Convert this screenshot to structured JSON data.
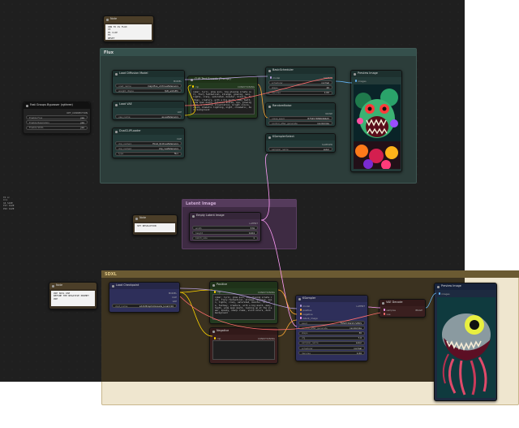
{
  "colors": {
    "flux_group": "#2f4642",
    "sdxl_group": "#58472a",
    "latent_group": "#4e2f55",
    "link_clip": "#ffd500",
    "link_model": "#b39ddb",
    "link_cond": "#ffa931",
    "link_latent": "#ff9cf9",
    "link_vae": "#ff6e6e",
    "link_image": "#64b5f6"
  },
  "side_text": "TO A:\nC=1\n16 SIZE\nFIT SIZE\nPIX SIZE",
  "groups": {
    "flux": "Flux",
    "latent": "Latent Image",
    "sdxl": "SDXL"
  },
  "notes": [
    {
      "title": "Note",
      "text": "CNN TO IS FLUX\nCX\nPS CLIP\nFX\nRESET"
    },
    {
      "title": "Note",
      "text": "SET RESOLUTION"
    },
    {
      "title": "Note",
      "text": "USE SDXL USE\nREFINE THE NEGATIVE PROMPT\nUSE"
    }
  ],
  "bypasser": {
    "title": "Fast Groups Bypasser (rgthree)",
    "output": "OPT_CONNECTION",
    "items": [
      {
        "label": "Enable Flux",
        "state": "yes"
      },
      {
        "label": "Enable Resolution",
        "state": "yes"
      },
      {
        "label": "Enable SDXL",
        "state": "yes"
      }
    ]
  },
  "load_diffusion": {
    "title": "Load Diffusion Model",
    "output": "MODEL",
    "w1": {
      "k": "unet_name",
      "v": "majicflus_v134.safetensors"
    },
    "w2": {
      "k": "weight_dtype",
      "v": "fp8_e4m3fn"
    }
  },
  "load_vae": {
    "title": "Load VAE",
    "output": "VAE",
    "w1": {
      "k": "vae_name",
      "v": "ae.safetensors"
    }
  },
  "dual_clip": {
    "title": "DualCLIPLoader",
    "output": "CLIP",
    "w1": {
      "k": "clip_name1",
      "v": "t5xxl_fp16.safetensors"
    },
    "w2": {
      "k": "clip_name2",
      "v": "clip_l.safetensors"
    },
    "w3": {
      "k": "type",
      "v": "flux"
    }
  },
  "clip_flux": {
    "title": "CLIP Text Encode (Prompt)",
    "in": "clip",
    "out": "CONDITIONING",
    "text": "cyber, lyric, glow quiv, big glowing ornate coil, fiery fantastical, strange, glowing, neon, lights, crazy, saturated, monster, bizarre, fantasy, creature, with a big mouth, many teeth, wide open mouth, detailed scales, eye, glowing eyes, a colorful illustration, bright colors, vivid, dramatic lighting, night, cinematic, dark background"
  },
  "basic_scheduler": {
    "title": "BasicScheduler",
    "in": "model",
    "out": "SIGMAS",
    "w1": {
      "k": "scheduler",
      "v": "normal"
    },
    "w2": {
      "k": "steps",
      "v": "20"
    },
    "w3": {
      "k": "denoise",
      "v": "1.00"
    }
  },
  "random_noise": {
    "title": "RandomNoise",
    "out": "NOISE",
    "w1": {
      "k": "noise_seed",
      "v": "875457858696625"
    },
    "w2": {
      "k": "control_after_generate",
      "v": "randomize"
    }
  },
  "ksampler_select": {
    "title": "KSamplerSelect",
    "out": "SAMPLER",
    "w1": {
      "k": "sampler_name",
      "v": "euler"
    }
  },
  "preview_flux": {
    "title": "Preview Image",
    "in": "images"
  },
  "empty_latent": {
    "title": "Empty Latent Image",
    "out": "LATENT",
    "w1": {
      "k": "width",
      "v": "576"
    },
    "w2": {
      "k": "height",
      "v": "1024"
    },
    "w3": {
      "k": "batch_size",
      "v": "1"
    }
  },
  "load_ckpt": {
    "title": "Load Checkpoint",
    "outs": [
      "MODEL",
      "CLIP",
      "VAE"
    ],
    "w1": {
      "k": "ckpt_name",
      "v": "sdxlUltraphotorealis_lunarV10"
    }
  },
  "positive": {
    "title": "Positive",
    "in": "clip",
    "out": "CONDITIONING",
    "text": "cyber, lyric, glow quiv, big glowing ornate coil, fiery fantastical, strange, glowing, neon, lights, crazy, saturated, monster, bizarre, fantasy, creature, with a big mouth, many teeth, wide open mouth, looking up at the viewer, spooky, sharp claws, vivid colors, dark background"
  },
  "negative": {
    "title": "Negative",
    "in": "clip",
    "out": "CONDITIONING"
  },
  "ksampler": {
    "title": "KSampler",
    "ins": [
      "model",
      "positive",
      "negative",
      "latent_image"
    ],
    "out": "LATENT",
    "widgets": [
      {
        "k": "seed",
        "v": "765873921572855"
      },
      {
        "k": "control_after_generate",
        "v": "randomize"
      },
      {
        "k": "steps",
        "v": "30"
      },
      {
        "k": "cfg",
        "v": "7.0"
      },
      {
        "k": "sampler_name",
        "v": "euler"
      },
      {
        "k": "scheduler",
        "v": "normal"
      },
      {
        "k": "denoise",
        "v": "1.00"
      }
    ]
  },
  "vae_decode": {
    "title": "VAE Decode",
    "ins": [
      "samples",
      "vae"
    ],
    "out": "IMAGE"
  },
  "preview_sdxl": {
    "title": "Preview Image",
    "in": "images"
  }
}
